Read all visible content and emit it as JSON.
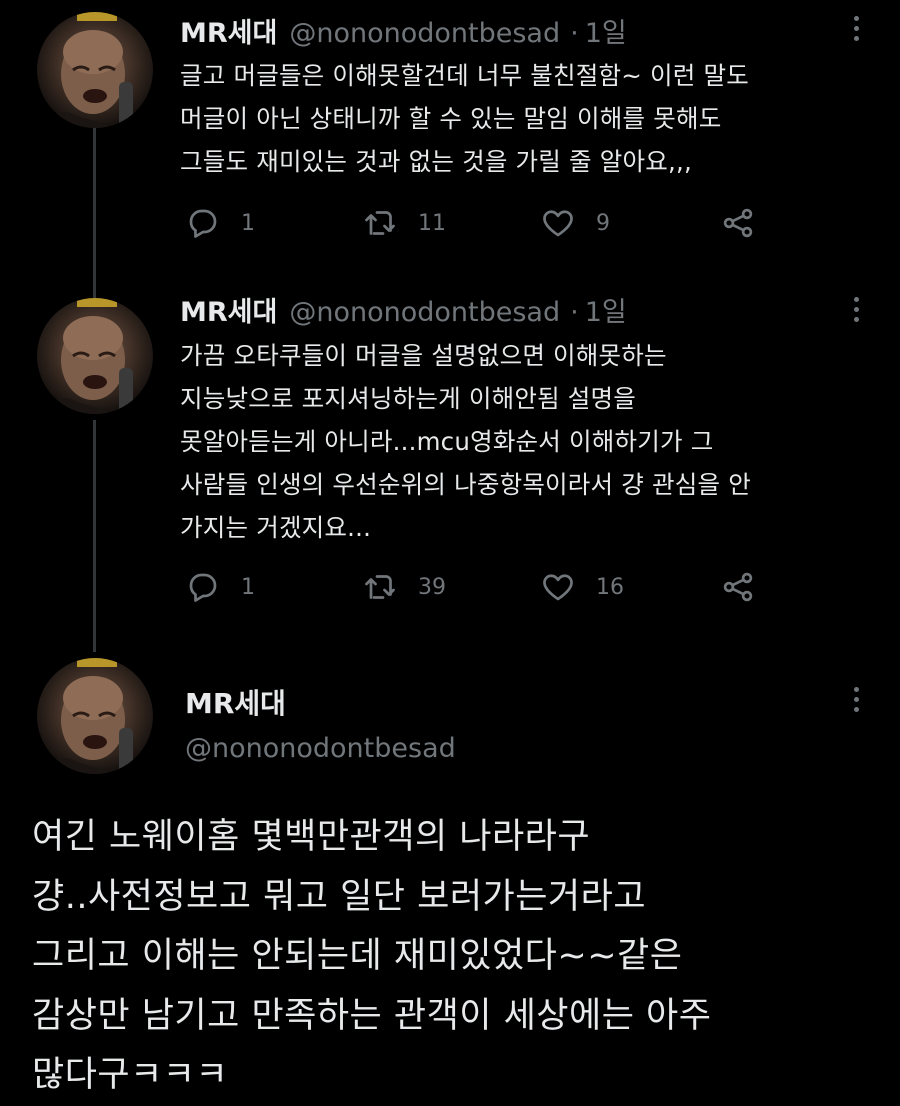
{
  "tweets": [
    {
      "name": "MR세대",
      "handle": "@nononodontbesad",
      "separator": "·",
      "time": "1일",
      "text": "글고 머글들은 이해못할건데 너무 불친절함~ 이런 말도\n머글이 아닌 상태니까 할 수 있는 말임 이해를 못해도\n그들도 재미있는 것과 없는 것을 가릴 줄 알아요,,,",
      "replies": "1",
      "retweets": "11",
      "likes": "9"
    },
    {
      "name": "MR세대",
      "handle": "@nononodontbesad",
      "separator": "·",
      "time": "1일",
      "text": "가끔 오타쿠들이 머글을 설명없으면 이해못하는\n지능낮으로 포지셔닝하는게 이해안됨 설명을\n못알아듣는게 아니라...mcu영화순서 이해하기가 그\n사람들 인생의 우선순위의 나중항목이라서 걍 관심을 안\n가지는 거겠지요...",
      "replies": "1",
      "retweets": "39",
      "likes": "16"
    }
  ],
  "main_tweet": {
    "name": "MR세대",
    "handle": "@nononodontbesad",
    "text": "여긴 노웨이홈 몇백만관객의 나라라구\n걍..사전정보고 뭐고 일단 보러가는거라고\n그리고 이해는 안되는데 재미있었다~~같은\n감상만 남기고 만족하는 관객이 세상에는 아주\n많다구ㅋㅋㅋ"
  },
  "icons": {
    "reply": "reply-icon",
    "retweet": "retweet-icon",
    "like": "heart-icon",
    "share": "share-icon",
    "more": "more-options-icon"
  },
  "colors": {
    "background": "#000000",
    "text": "#e7e9ea",
    "secondary": "#71767b",
    "thread_line": "#333639"
  }
}
